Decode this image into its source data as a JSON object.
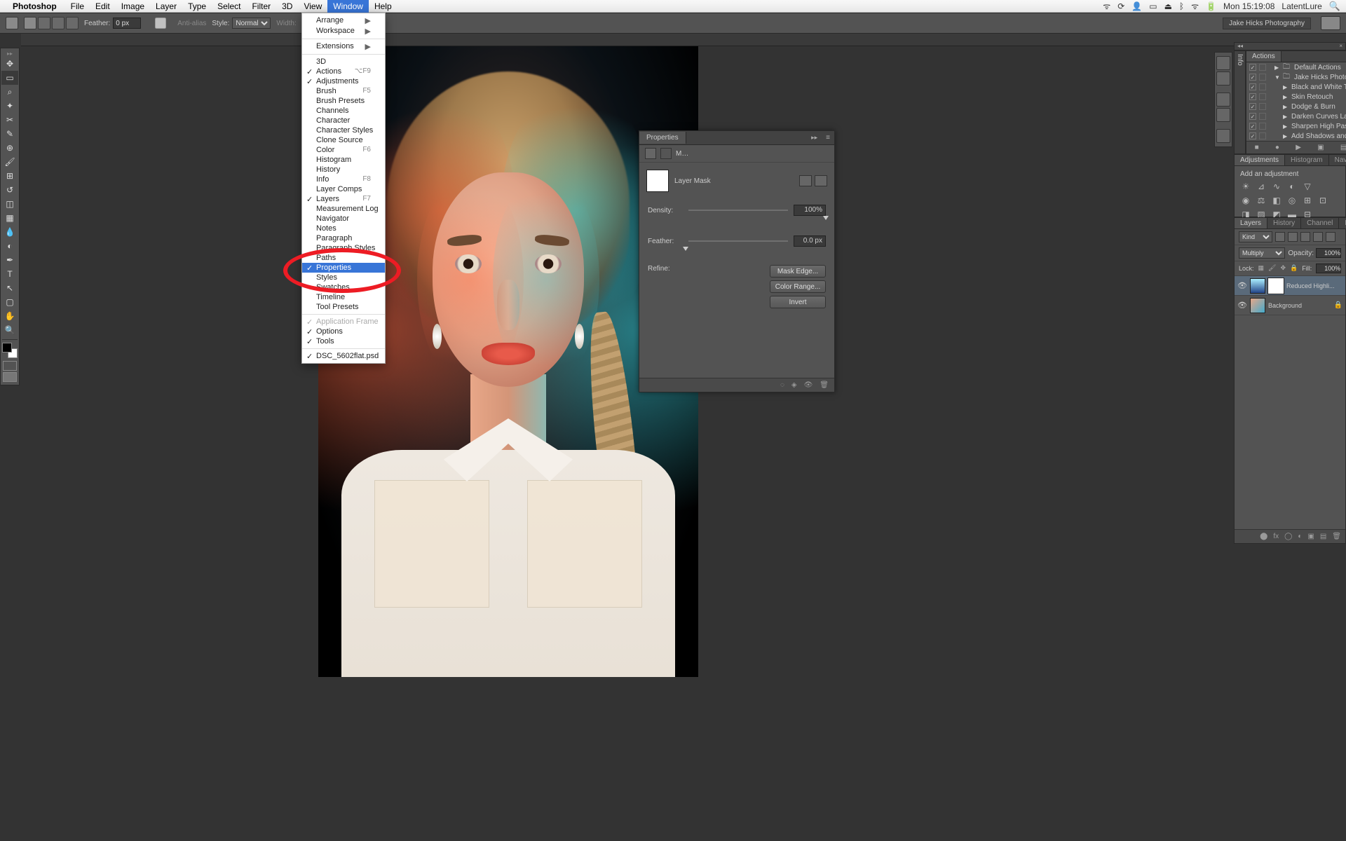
{
  "menubar": {
    "app": "Photoshop",
    "items": [
      "File",
      "Edit",
      "Image",
      "Layer",
      "Type",
      "Select",
      "Filter",
      "3D",
      "View",
      "Window",
      "Help"
    ],
    "active": "Window",
    "status": {
      "time": "Mon 15:19:08",
      "user": "LatentLure"
    }
  },
  "options_bar": {
    "feather_label": "Feather:",
    "feather_value": "0 px",
    "antialias_label": "Anti-alias",
    "style_label": "Style:",
    "style_value": "Normal",
    "width_label": "Width:",
    "workspace": "Jake Hicks Photography"
  },
  "window_menu": {
    "top": [
      {
        "label": "Arrange",
        "submenu": true
      },
      {
        "label": "Workspace",
        "submenu": true
      }
    ],
    "extensions": {
      "label": "Extensions",
      "submenu": true
    },
    "list": [
      {
        "label": "3D"
      },
      {
        "label": "Actions",
        "shortcut": "⌥F9",
        "checked": true
      },
      {
        "label": "Adjustments",
        "checked": true
      },
      {
        "label": "Brush",
        "shortcut": "F5"
      },
      {
        "label": "Brush Presets"
      },
      {
        "label": "Channels"
      },
      {
        "label": "Character"
      },
      {
        "label": "Character Styles"
      },
      {
        "label": "Clone Source"
      },
      {
        "label": "Color",
        "shortcut": "F6"
      },
      {
        "label": "Histogram"
      },
      {
        "label": "History"
      },
      {
        "label": "Info",
        "shortcut": "F8"
      },
      {
        "label": "Layer Comps"
      },
      {
        "label": "Layers",
        "shortcut": "F7",
        "checked": true
      },
      {
        "label": "Measurement Log"
      },
      {
        "label": "Navigator"
      },
      {
        "label": "Notes"
      },
      {
        "label": "Paragraph"
      },
      {
        "label": "Paragraph Styles"
      },
      {
        "label": "Paths"
      },
      {
        "label": "Properties",
        "checked": true,
        "highlighted": true
      },
      {
        "label": "Styles"
      },
      {
        "label": "Swatches"
      },
      {
        "label": "Timeline"
      },
      {
        "label": "Tool Presets"
      }
    ],
    "bottom": [
      {
        "label": "Application Frame",
        "checked": true,
        "disabled": true
      },
      {
        "label": "Options",
        "checked": true
      },
      {
        "label": "Tools",
        "checked": true
      }
    ],
    "document": {
      "label": "DSC_5602flat.psd",
      "checked": true
    }
  },
  "properties": {
    "tab": "Properties",
    "sub": "M…",
    "title": "Layer Mask",
    "density_label": "Density:",
    "density_value": "100%",
    "feather_label": "Feather:",
    "feather_value": "0.0 px",
    "refine_label": "Refine:",
    "mask_edge_btn": "Mask Edge...",
    "color_range_btn": "Color Range...",
    "invert_btn": "Invert"
  },
  "info_tab": "Info",
  "actions": {
    "tab": "Actions",
    "rows": [
      {
        "name": "Default Actions",
        "folder": true,
        "expanded": false,
        "indent": 0
      },
      {
        "name": "Jake Hicks Photography ...",
        "folder": true,
        "expanded": true,
        "indent": 0,
        "selected": false
      },
      {
        "name": "Black and White Tone Pr...",
        "indent": 1
      },
      {
        "name": "Skin Retouch",
        "indent": 1
      },
      {
        "name": "Dodge & Burn",
        "indent": 1
      },
      {
        "name": "Darken Curves Layers",
        "indent": 1
      },
      {
        "name": "Sharpen High Pass Set",
        "indent": 1
      },
      {
        "name": "Add Shadows and Highli...",
        "indent": 1
      }
    ]
  },
  "adjustments": {
    "tabs": [
      "Adjustments",
      "Histogram",
      "Navigato"
    ],
    "add_label": "Add an adjustment"
  },
  "layers": {
    "tabs": [
      "Layers",
      "History",
      "Channel",
      "Paths"
    ],
    "kind_label": "Kind",
    "blend_mode": "Multiply",
    "opacity_label": "Opacity:",
    "opacity_value": "100%",
    "lock_label": "Lock:",
    "fill_label": "Fill:",
    "fill_value": "100%",
    "rows": [
      {
        "name": "Reduced Highli...",
        "selected": true,
        "hasMask": true,
        "adj": true
      },
      {
        "name": "Background",
        "locked": true
      }
    ]
  }
}
